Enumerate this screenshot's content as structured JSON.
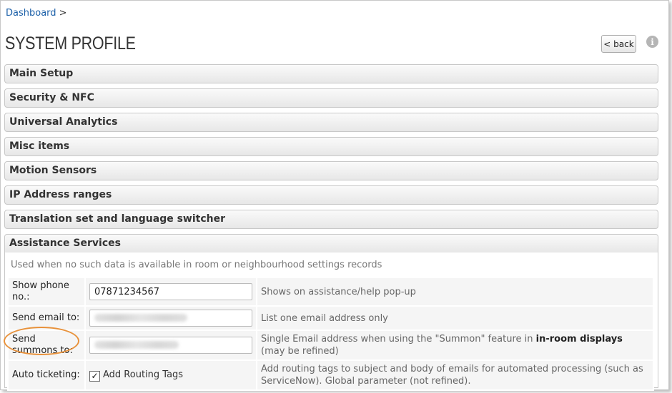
{
  "breadcrumb": {
    "link": "Dashboard",
    "separator": ">"
  },
  "page": {
    "title": "SYSTEM PROFILE",
    "back_label": "< back",
    "info_glyph": "i"
  },
  "sections": [
    {
      "label": "Main Setup"
    },
    {
      "label": "Security & NFC"
    },
    {
      "label": "Universal Analytics"
    },
    {
      "label": "Misc items"
    },
    {
      "label": "Motion Sensors"
    },
    {
      "label": "IP Address ranges"
    },
    {
      "label": "Translation set and language switcher"
    },
    {
      "label": "Assistance Services"
    }
  ],
  "assistance": {
    "note": "Used when no such data is available in room or neighbourhood settings records",
    "rows": [
      {
        "label": "Show phone no.:",
        "value": "07871234567",
        "desc": "Shows on assistance/help pop-up"
      },
      {
        "label": "Send email to:",
        "value": "",
        "desc": "List one email address only"
      },
      {
        "label": "Send summons to:",
        "value": "",
        "desc_pre": "Single Email address when using the \"Summon\" feature in ",
        "desc_bold": "in-room displays",
        "desc_post": " (may be refined)"
      },
      {
        "label": "Auto ticketing:",
        "checkbox_label": "Add Routing Tags",
        "checked": true,
        "desc": "Add routing tags to subject and body of emails for automated processing (such as ServiceNow). Global parameter (not refined)."
      }
    ]
  },
  "colors": {
    "link": "#1a5fa8",
    "highlight": "#e8913a"
  }
}
